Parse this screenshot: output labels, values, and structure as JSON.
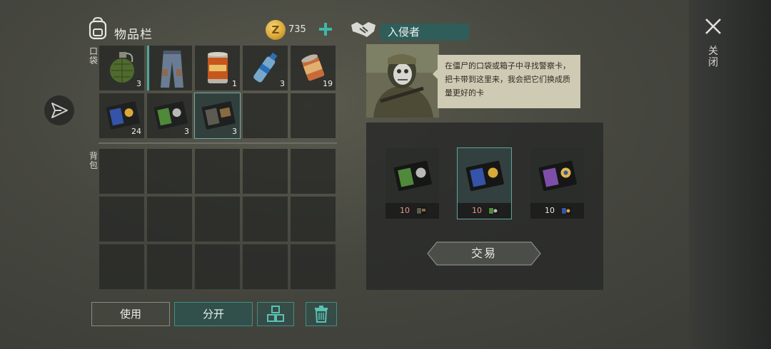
{
  "header": {
    "inventory_title": "物品栏",
    "coins": "735"
  },
  "inventory": {
    "pocket_label": "口袋",
    "backpack_label": "背包",
    "pocket_slots": [
      {
        "item": "grenade",
        "count": "3"
      },
      {
        "item": "jeans",
        "count": ""
      },
      {
        "item": "canned-food",
        "count": "1"
      },
      {
        "item": "water-bottle",
        "count": "3"
      },
      {
        "item": "open-can",
        "count": "19"
      },
      {
        "item": "police-card-blue",
        "count": "24"
      },
      {
        "item": "police-card-green",
        "count": "3"
      },
      {
        "item": "police-card-gray",
        "count": "3"
      },
      {
        "item": "",
        "count": ""
      },
      {
        "item": "",
        "count": ""
      }
    ]
  },
  "buttons": {
    "use": "使用",
    "split": "分开"
  },
  "trader": {
    "name": "入侵者",
    "message": "在僵尸的口袋或箱子中寻找警察卡，把卡带到这里来，我会把它们换成质量更好的卡",
    "offers": [
      {
        "card": "green",
        "price": "10",
        "cost_card": "gray"
      },
      {
        "card": "blue",
        "price": "10",
        "cost_card": "green"
      },
      {
        "card": "purple",
        "price": "10",
        "cost_card": "blue"
      }
    ],
    "trade_button": "交易"
  },
  "close_label": "关闭",
  "colors": {
    "accent": "#3fb7a6",
    "selected_outline": "#6fa8a2",
    "trader_name_bg": "#2f5d59"
  }
}
